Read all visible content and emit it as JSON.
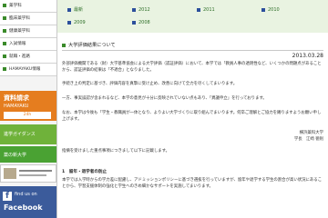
{
  "sidebar": {
    "items": [
      {
        "label": "薬学科"
      },
      {
        "label": "臨床薬学科"
      },
      {
        "label": "健康薬学科"
      },
      {
        "label": "入試情報"
      },
      {
        "label": "就職・進路"
      },
      {
        "label": "HAMAYAKU情報"
      }
    ],
    "banners": {
      "request": {
        "line1": "資料請求",
        "line2": "HAMAYAKU",
        "note": "24h"
      },
      "guidance": {
        "label": "進学ガイダンス"
      },
      "chat": {
        "label": "薬の新大学"
      },
      "facebook": {
        "line1": "find us on",
        "line2": "Facebook"
      }
    }
  },
  "tabs": [
    {
      "label": "最新"
    },
    {
      "label": "2012"
    },
    {
      "label": "2011"
    },
    {
      "label": "2010"
    },
    {
      "label": "2009"
    },
    {
      "label": "2008"
    }
  ],
  "article": {
    "title": "大学評価結果について",
    "date": "2013.03.28",
    "p1": "外部評価機関である（財）大学基準協会による大学評価（認証評価）において、本学では「教員人事の透明性など、いくつかの問題点があることから、認証評価の結果は「不適合」となりました。",
    "p2": "手続き上の判定に基づき、評価内容を真摯に受け止め、改善に向けて全力を尽くしてまいります。",
    "p3": "一方、事実誤認が含まれるなど、本学の意見が十分に反映されていない点もあり、「異議申立」を行っております。",
    "p4": "なお、本学は今後も「学生・教職員が一体となり、よりよい大学づくりに取り組んでまいります。何卒ご理解とご協力を賜りますようお願い申し上げます。",
    "signature_org": "横浜薬科大学",
    "signature_name": "学長　江崎 徳則",
    "intro": "指摘を受けました重点事項につきまして以下に記載します。",
    "section1": "1　留年・退学者の防止",
    "s1p": "本学では入学時からの学力差に配慮し、アドミッションポリシーに基づき選抜を行っていますが、留年や退学する学生の割合が高い状況にあることから、学習支援体制の強化と学生へのきめ細かなサポートを実施してまいります。"
  }
}
